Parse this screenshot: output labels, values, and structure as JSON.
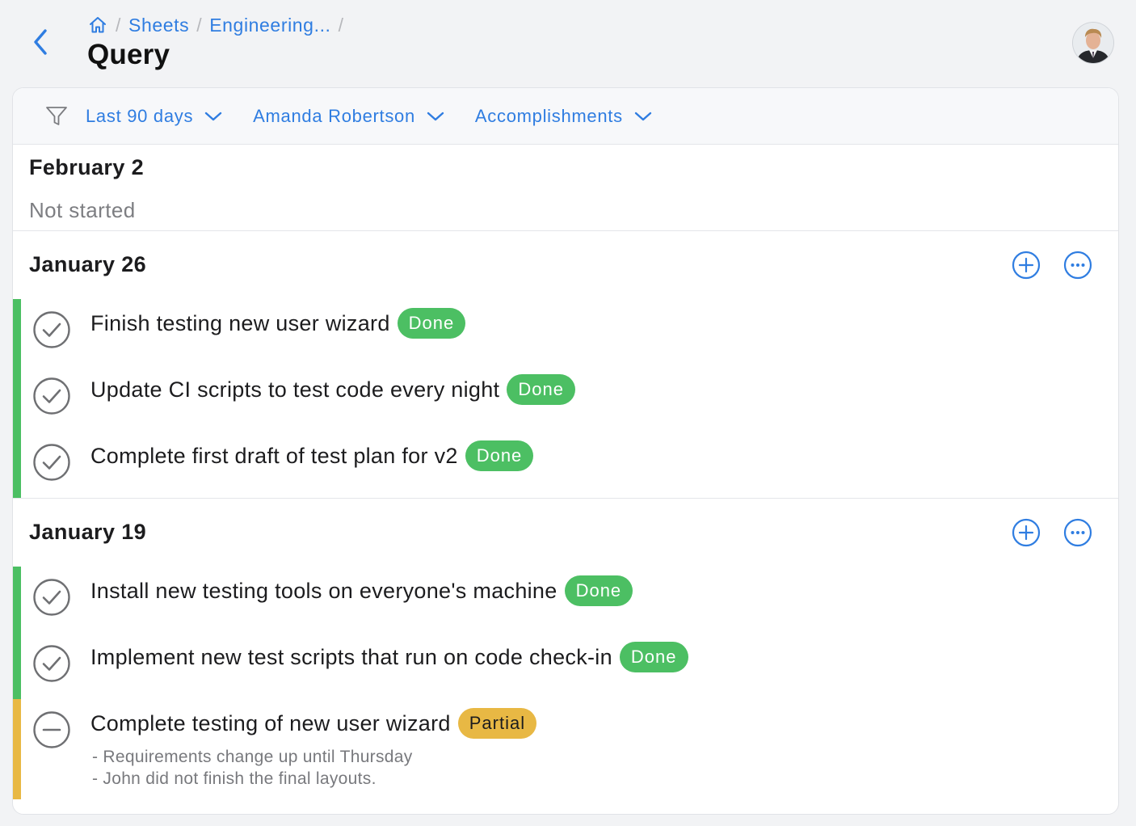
{
  "header": {
    "breadcrumb": {
      "home_icon": "home-icon",
      "items": [
        "Sheets",
        "Engineering..."
      ],
      "separator": "/"
    },
    "title": "Query",
    "back_icon": "chevron-left-icon"
  },
  "filters": {
    "icon": "filter-icon",
    "dropdowns": [
      {
        "label": "Last 90 days"
      },
      {
        "label": "Amanda Robertson"
      },
      {
        "label": "Accomplishments"
      }
    ]
  },
  "sections": [
    {
      "date": "February 2",
      "status_text": "Not started"
    },
    {
      "date": "January 26",
      "items": [
        {
          "text": "Finish testing new user wizard",
          "status": "Done"
        },
        {
          "text": "Update CI scripts to test code every night",
          "status": "Done"
        },
        {
          "text": "Complete first draft of test plan for v2",
          "status": "Done"
        }
      ]
    },
    {
      "date": "January 19",
      "items": [
        {
          "text": "Install new testing tools on everyone's machine",
          "status": "Done"
        },
        {
          "text": "Implement new test scripts that run on code check-in",
          "status": "Done"
        },
        {
          "text": "Complete testing of new user wizard",
          "status": "Partial",
          "notes": [
            "- Requirements change up until Thursday",
            "- John did not finish the final layouts."
          ]
        }
      ]
    }
  ],
  "colors": {
    "accent": "#2f7de1",
    "done": "#4cbf63",
    "partial": "#e8b844"
  }
}
